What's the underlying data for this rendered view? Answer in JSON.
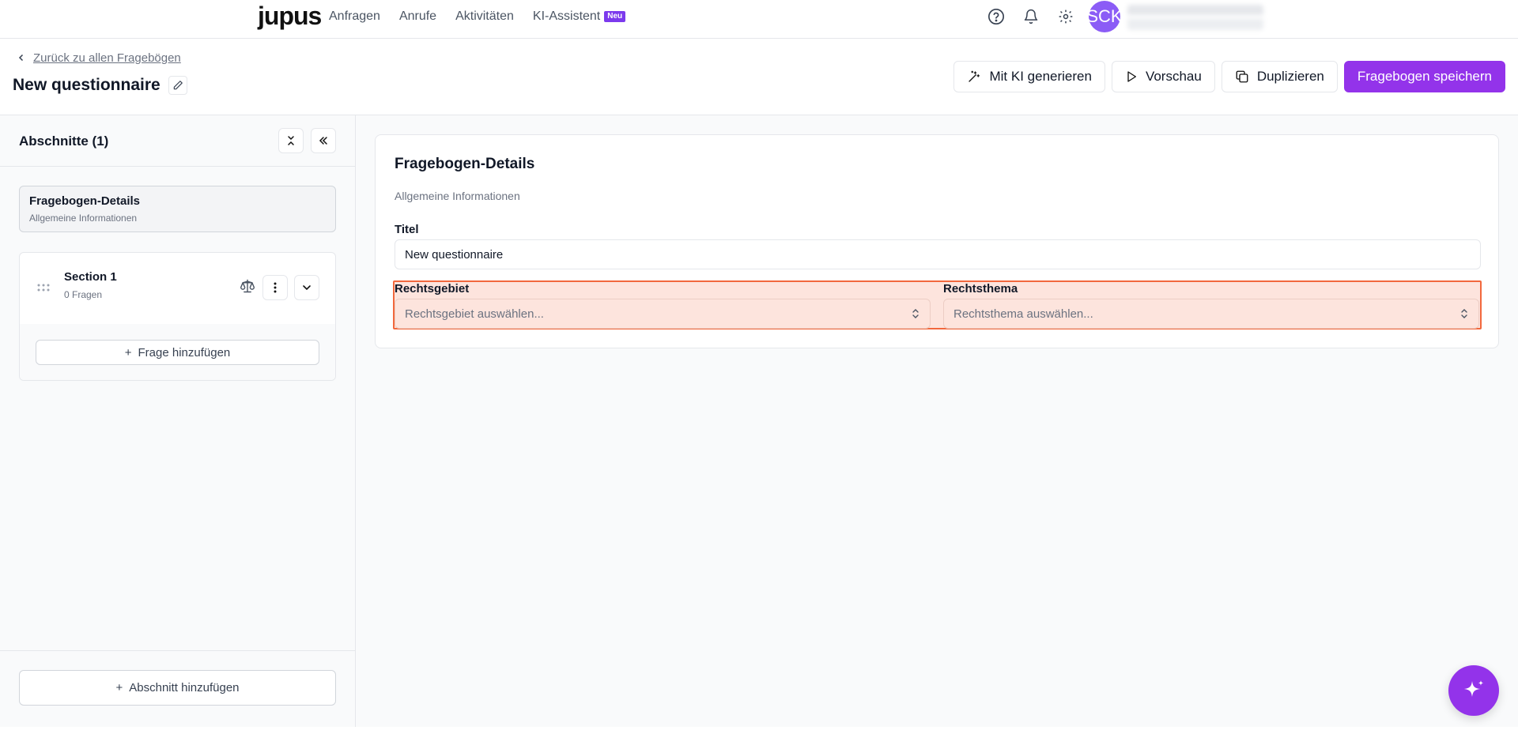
{
  "nav": {
    "logo": "jupus",
    "links": [
      "Anfragen",
      "Anrufe",
      "Aktivitäten",
      "KI-Assistent"
    ],
    "badge": "Neu",
    "icons": [
      "help-icon",
      "bell-icon",
      "gear-icon"
    ],
    "avatar_initials": "SCK"
  },
  "header": {
    "back_link": "Zurück zu allen Fragebögen",
    "title": "New questionnaire",
    "actions": {
      "generate": "Mit KI generieren",
      "preview": "Vorschau",
      "duplicate": "Duplizieren",
      "save": "Fragebogen speichern"
    }
  },
  "sidebar": {
    "title": "Abschnitte (1)",
    "details": {
      "title": "Fragebogen-Details",
      "subtitle": "Allgemeine Informationen"
    },
    "section": {
      "title": "Section 1",
      "subtitle": "0 Fragen",
      "add_question": "Frage hinzufügen"
    },
    "add_section": "Abschnitt hinzufügen"
  },
  "form": {
    "title": "Fragebogen-Details",
    "subtitle": "Allgemeine Informationen",
    "title_label": "Titel",
    "title_value": "New questionnaire",
    "area_label": "Rechtsgebiet",
    "area_placeholder": "Rechtsgebiet auswählen...",
    "topic_label": "Rechtsthema",
    "topic_placeholder": "Rechtsthema auswählen..."
  },
  "colors": {
    "accent": "#9333ea",
    "highlight_fill": "#fde4dd",
    "highlight_border": "#f2683d"
  }
}
